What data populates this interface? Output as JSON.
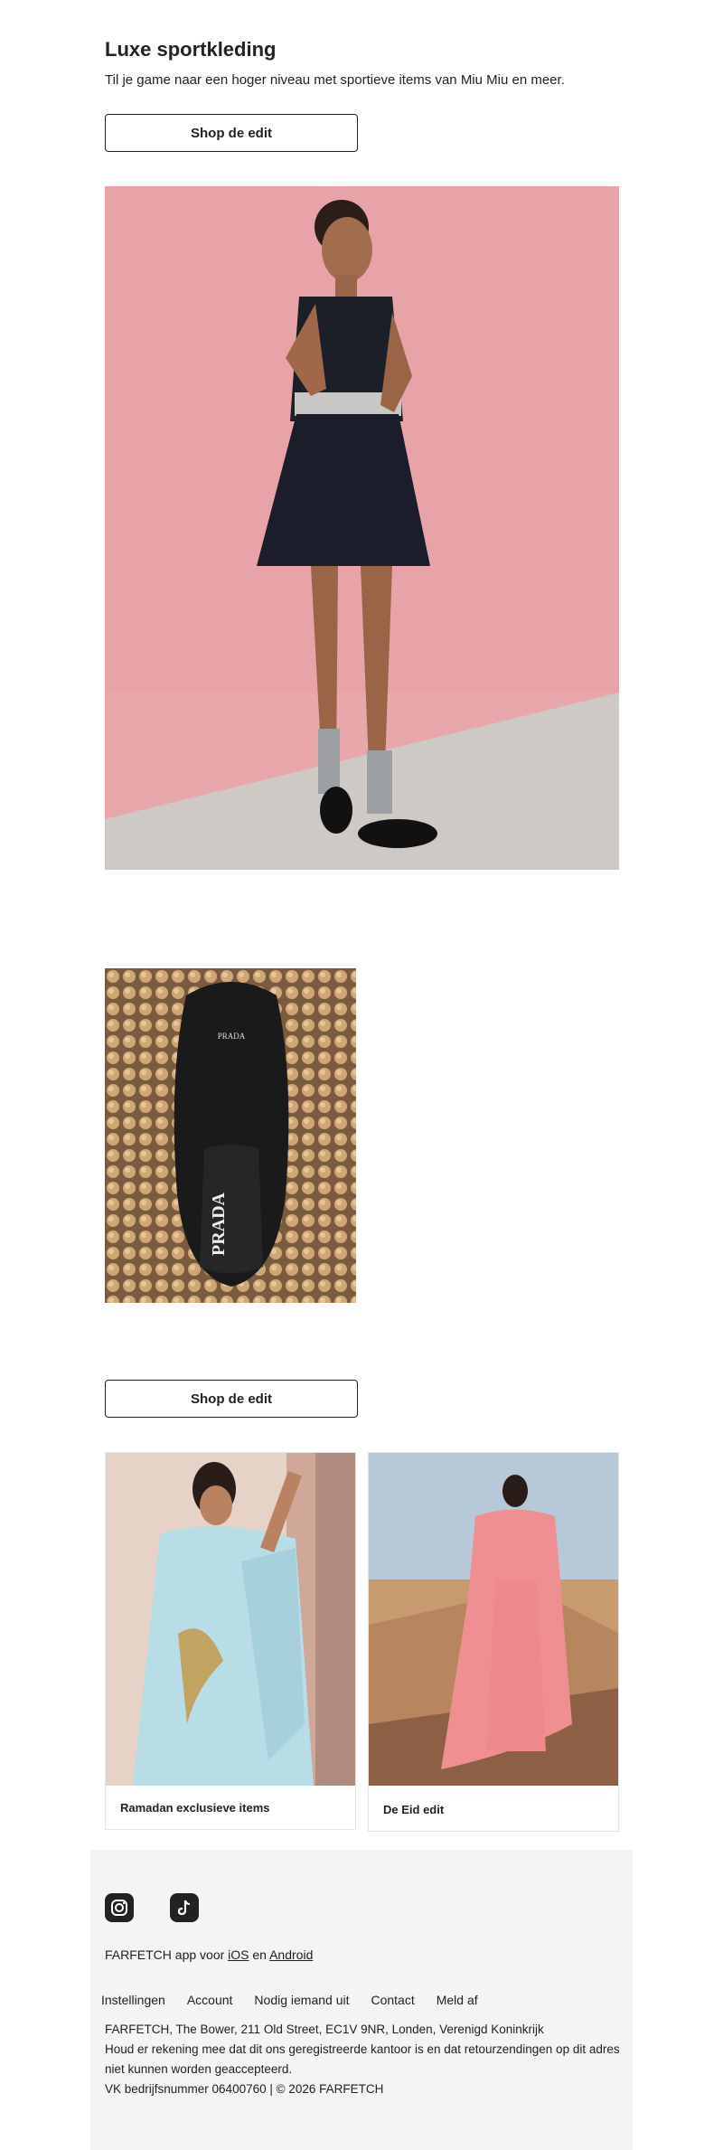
{
  "header": {
    "title": "Luxe sportkleding",
    "subtitle": "Til je game naar een hoger niveau met sportieve items van Miu Miu en meer."
  },
  "cta": {
    "primary_label": "Shop de edit",
    "secondary_label": "Shop de edit"
  },
  "product_images": {
    "shoe_brand": "PRADA"
  },
  "cards": [
    {
      "title": "Ramadan exclusieve items"
    },
    {
      "title": "De Eid edit"
    }
  ],
  "footer": {
    "social": [
      "instagram-icon",
      "tiktok-icon"
    ],
    "app_prefix": "FARFETCH app voor ",
    "app_ios": "iOS",
    "app_mid": " en ",
    "app_android": "Android",
    "links": [
      "Instellingen",
      "Account",
      "Nodig iemand uit",
      "Contact",
      "Meld af"
    ],
    "address": "FARFETCH, The Bower, 211 Old Street, EC1V 9NR, Londen, Verenigd Koninkrijk",
    "notice": "Houd er rekening mee dat dit ons geregistreerde kantoor is en dat retourzendingen op dit adres niet kunnen worden geaccepteerd.",
    "company": "VK bedrijfsnummer 06400760 | © 2026 FARFETCH"
  },
  "colors": {
    "text": "#222222",
    "footer_bg": "#f4f4f4",
    "hero_wall": "#e7a7ab",
    "card_pink": "#f08f92",
    "card_blue": "#b9dde7"
  }
}
